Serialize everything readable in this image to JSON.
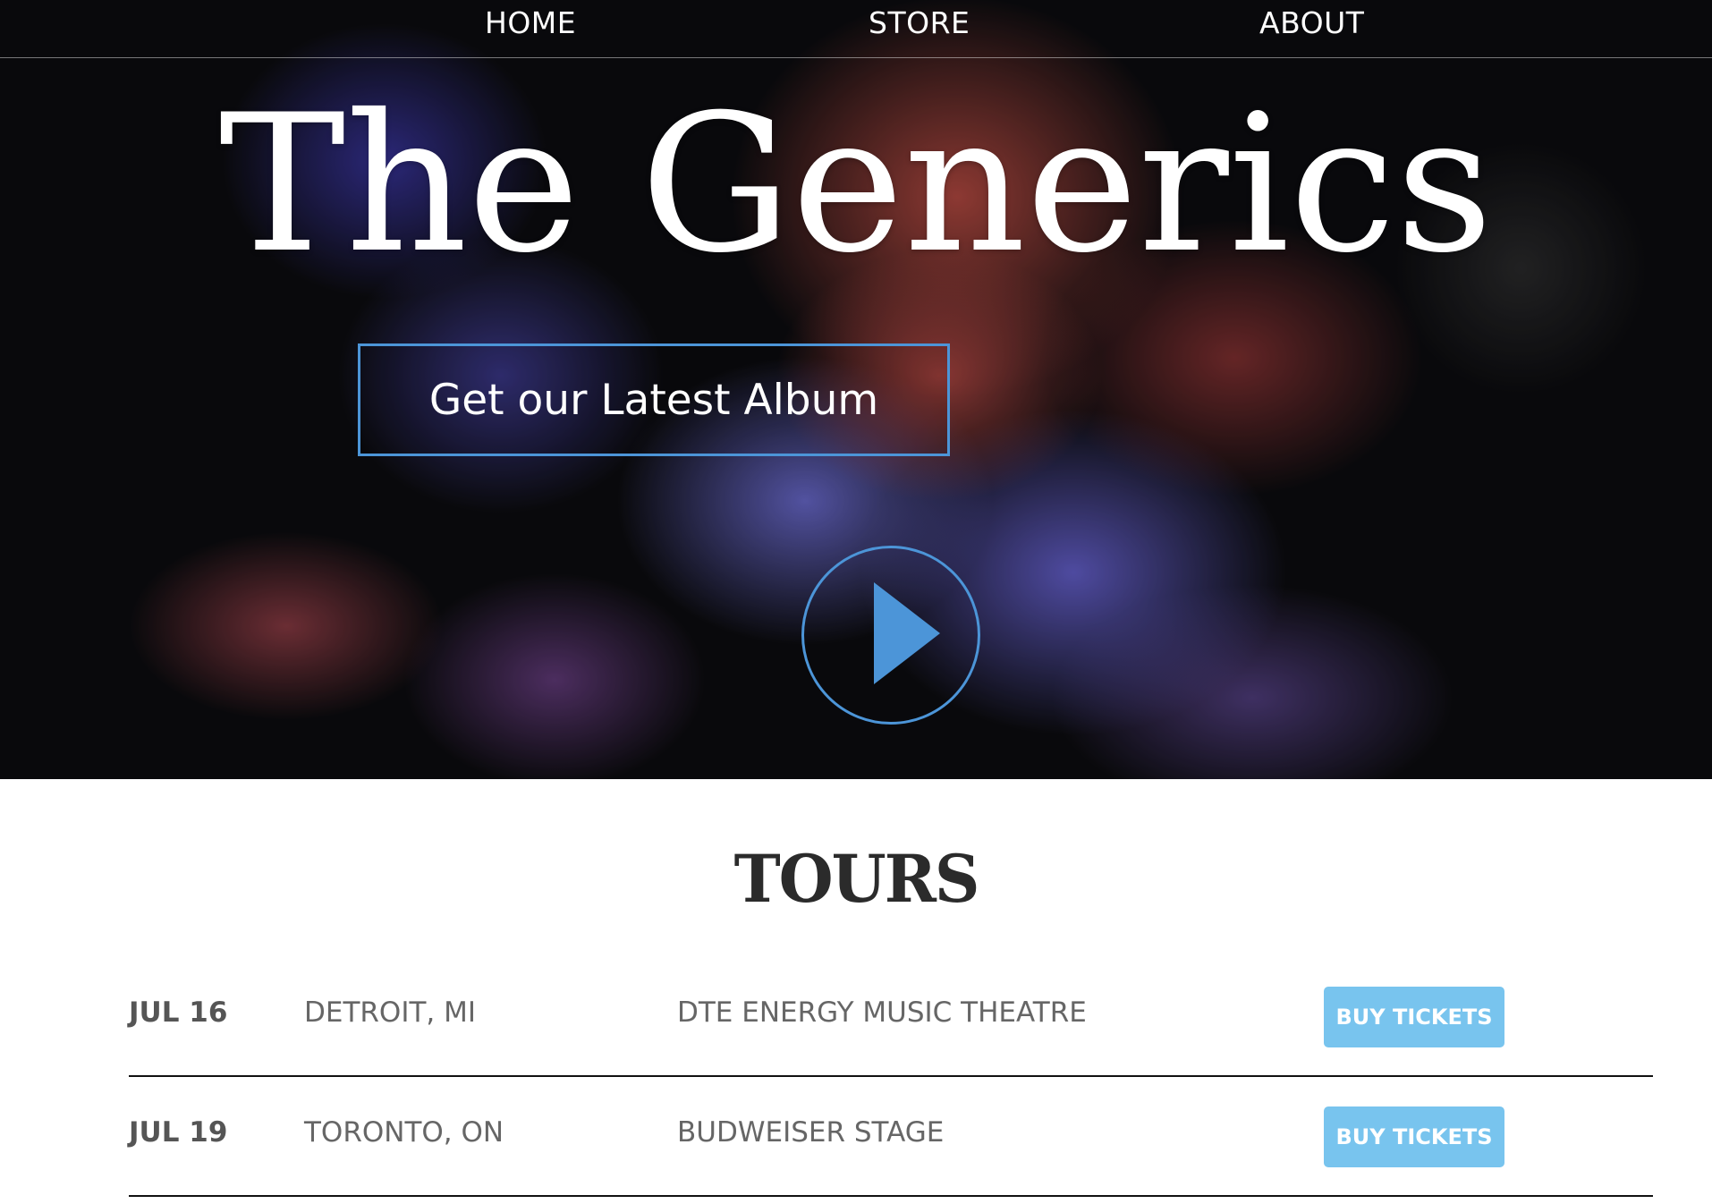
{
  "nav": {
    "home": "HOME",
    "store": "STORE",
    "about": "ABOUT"
  },
  "hero": {
    "title": "The Generics",
    "album_button": "Get our Latest Album",
    "play_icon": "play-icon"
  },
  "tours": {
    "heading": "TOURS",
    "rows": [
      {
        "date": "JUL 16",
        "city": "DETROIT, MI",
        "venue": "DTE ENERGY MUSIC THEATRE",
        "button": "BUY TICKETS"
      },
      {
        "date": "JUL 19",
        "city": "TORONTO, ON",
        "venue": "BUDWEISER STAGE",
        "button": "BUY TICKETS"
      }
    ]
  },
  "colors": {
    "accent_blue": "#4c95d8",
    "buy_button": "#78c4ee",
    "text_gray": "#666666",
    "heading_dark": "#2b2b2b"
  }
}
